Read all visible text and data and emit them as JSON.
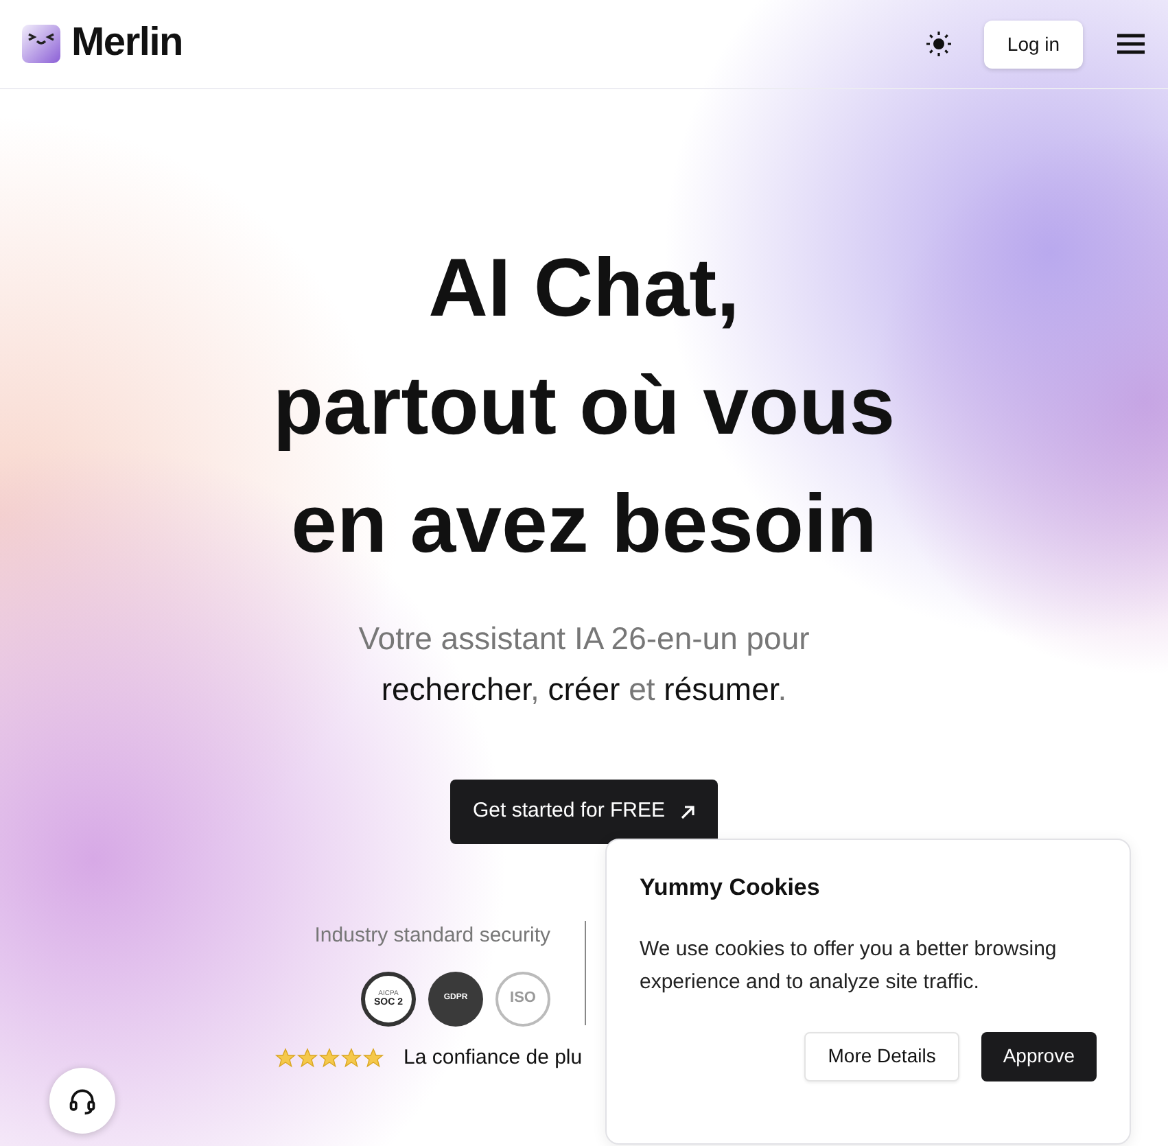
{
  "header": {
    "logo_text": "Merlin",
    "login": "Log in"
  },
  "hero": {
    "title_lines": [
      "AI Chat,",
      "partout où vous",
      "en avez besoin"
    ],
    "subtitle_line1": "Votre assistant IA 26-en-un pour",
    "subtitle_line2": [
      {
        "text": "rechercher",
        "emphasis": true
      },
      {
        "text": ", ",
        "emphasis": false
      },
      {
        "text": "créer",
        "emphasis": true
      },
      {
        "text": " et ",
        "emphasis": false
      },
      {
        "text": "résumer",
        "emphasis": true
      },
      {
        "text": ".",
        "emphasis": false
      }
    ],
    "cta": "Get started for FREE"
  },
  "security": {
    "label": "Industry standard security",
    "badges": [
      {
        "kind": "soc",
        "top": "AICPA",
        "text": "SOC 2"
      },
      {
        "kind": "gdpr",
        "text": "GDPR"
      },
      {
        "kind": "iso",
        "text": "ISO"
      }
    ]
  },
  "trust": {
    "stars": 5,
    "text": "La confiance de plu"
  },
  "cookie_banner": {
    "title": "Yummy Cookies",
    "body": "We use cookies to offer you a better browsing experience and to analyze site traffic.",
    "buttons": [
      {
        "label": "More Details",
        "kind": "secondary"
      },
      {
        "label": "Approve",
        "kind": "primary"
      }
    ]
  }
}
